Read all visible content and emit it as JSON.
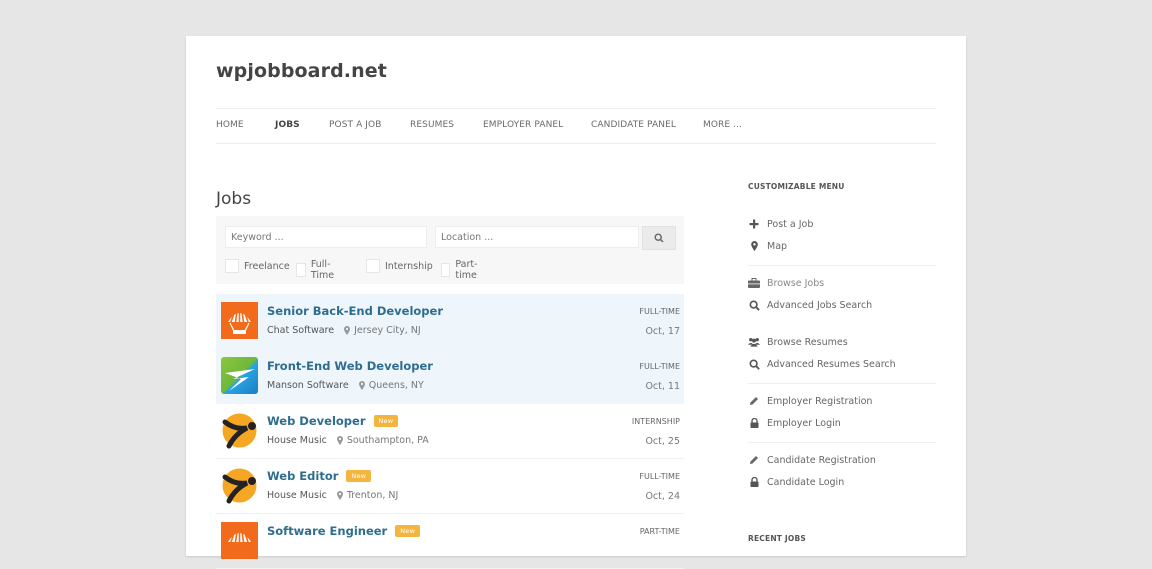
{
  "site": {
    "title": "wpjobboard.net"
  },
  "nav": {
    "items": [
      {
        "label": "Home",
        "active": false
      },
      {
        "label": "Jobs",
        "active": true
      },
      {
        "label": "Post a Job",
        "active": false
      },
      {
        "label": "Resumes",
        "active": false
      },
      {
        "label": "Employer Panel",
        "active": false
      },
      {
        "label": "Candidate Panel",
        "active": false
      },
      {
        "label": "More ...",
        "active": false
      }
    ]
  },
  "page": {
    "title": "Jobs"
  },
  "search": {
    "keyword_placeholder": "Keyword ...",
    "keyword_value": "",
    "location_placeholder": "Location ...",
    "location_value": "",
    "button_icon": "search-icon",
    "filters": [
      {
        "label": "Freelance",
        "checked": false
      },
      {
        "label": "Full-Time",
        "checked": false
      },
      {
        "label": "Internship",
        "checked": false
      },
      {
        "label": "Part-time",
        "checked": false
      }
    ]
  },
  "jobs": [
    {
      "title": "Senior Back-End Developer",
      "company": "Chat Software",
      "location": "Jersey City, NJ",
      "type": "Full-Time",
      "date": "Oct, 17",
      "featured": true,
      "is_new": false,
      "logo": "orange-parachute-logo"
    },
    {
      "title": "Front-End Web Developer",
      "company": "Manson Software",
      "location": "Queens, NY",
      "type": "Full-Time",
      "date": "Oct, 11",
      "featured": true,
      "is_new": false,
      "logo": "green-blue-plane-logo"
    },
    {
      "title": "Web Developer",
      "company": "House Music",
      "location": "Southampton, PA",
      "type": "Internship",
      "date": "Oct, 25",
      "featured": false,
      "is_new": true,
      "logo": "orange-circle-figure-logo"
    },
    {
      "title": "Web Editor",
      "company": "House Music",
      "location": "Trenton, NJ",
      "type": "Full-Time",
      "date": "Oct, 24",
      "featured": false,
      "is_new": true,
      "logo": "orange-circle-figure-logo"
    },
    {
      "title": "Software Engineer",
      "company": "",
      "location": "",
      "type": "Part-Time",
      "date": "",
      "featured": false,
      "is_new": true,
      "logo": "orange-parachute-logo"
    }
  ],
  "badge_new": "New",
  "sidebar": {
    "heading": "Customizable Menu",
    "groups": [
      [
        {
          "label": "Post a Job",
          "icon": "plus-icon"
        },
        {
          "label": "Map",
          "icon": "map-marker-icon"
        }
      ],
      [
        {
          "label": "Browse Jobs",
          "icon": "briefcase-icon"
        },
        {
          "label": "Advanced Jobs Search",
          "icon": "search-icon"
        }
      ],
      [
        {
          "label": "Browse Resumes",
          "icon": "users-icon"
        },
        {
          "label": "Advanced Resumes Search",
          "icon": "search-icon"
        }
      ],
      [
        {
          "label": "Employer Registration",
          "icon": "pencil-icon"
        },
        {
          "label": "Employer Login",
          "icon": "lock-icon"
        }
      ],
      [
        {
          "label": "Candidate Registration",
          "icon": "pencil-icon"
        },
        {
          "label": "Candidate Login",
          "icon": "lock-icon"
        }
      ]
    ],
    "recent_heading": "Recent Jobs"
  },
  "colors": {
    "link": "#2e6d8e",
    "badge": "#f4b53f",
    "featured_bg": "#eef6fc",
    "page_bg": "#e6e6e6"
  }
}
